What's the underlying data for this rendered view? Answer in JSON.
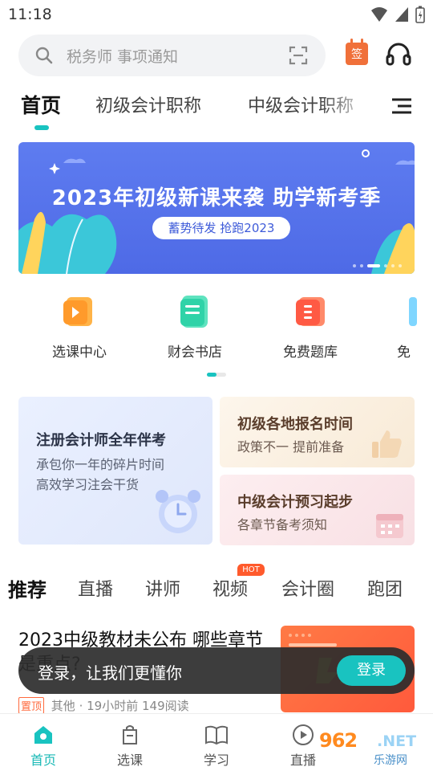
{
  "status_bar": {
    "time": "11:18"
  },
  "search": {
    "placeholder": "税务师 事项通知"
  },
  "header": {
    "sign_label": "签"
  },
  "category_tabs": [
    {
      "label": "首页",
      "active": true
    },
    {
      "label": "初级会计职称"
    },
    {
      "label": "中级会计职称"
    }
  ],
  "banner": {
    "title": "2023年初级新课来袭 助学新考季",
    "subtitle": "蓄势待发 抢跑2023"
  },
  "quick_entries": [
    {
      "label": "选课中心",
      "icon": "course-center-icon",
      "color": "#ffa12b"
    },
    {
      "label": "财会书店",
      "icon": "bookstore-icon",
      "color": "#2fd3a8"
    },
    {
      "label": "免费题库",
      "icon": "question-bank-icon",
      "color": "#ff5a44"
    },
    {
      "label": "免"
    }
  ],
  "promo_cards": {
    "big": {
      "title": "注册会计师全年伴考",
      "desc_line1": "承包你一年的碎片时间",
      "desc_line2": "高效学习注会干货"
    },
    "a": {
      "title": "初级各地报名时间",
      "desc": "政策不一 提前准备"
    },
    "b": {
      "title": "中级会计预习起步",
      "desc": "各章节备考须知"
    }
  },
  "content_tabs": [
    {
      "label": "推荐",
      "active": true
    },
    {
      "label": "直播"
    },
    {
      "label": "讲师"
    },
    {
      "label": "视频",
      "badge": "HOT"
    },
    {
      "label": "会计圈"
    },
    {
      "label": "跑团"
    }
  ],
  "article": {
    "title": "2023中级教材未公布 哪些章节是重点?",
    "tag": "置顶",
    "category": "其他",
    "time": "19小时前",
    "reads": "149阅读"
  },
  "login_toast": {
    "text": "登录，让我们更懂你",
    "button": "登录"
  },
  "bottom_nav": [
    {
      "label": "首页",
      "active": true
    },
    {
      "label": "选课"
    },
    {
      "label": "学习"
    },
    {
      "label": "直播"
    }
  ],
  "watermark": {
    "num": "962",
    "net": ".NET",
    "sub": "乐游网"
  },
  "colors": {
    "accent": "#19c3c0",
    "banner": "#5e7cf0",
    "hot": "#ff5a2c"
  }
}
